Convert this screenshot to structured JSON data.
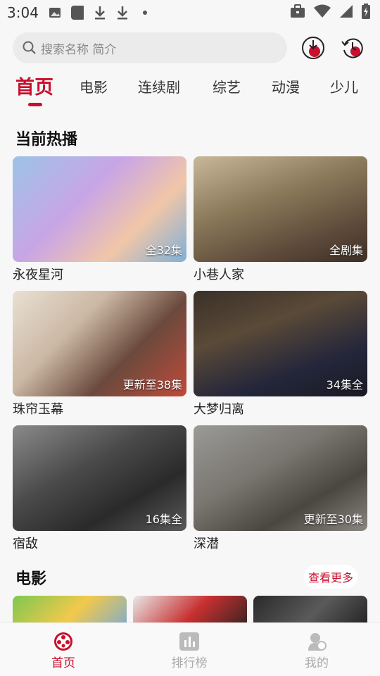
{
  "status_bar": {
    "time": "3:04"
  },
  "search": {
    "placeholder": "搜索名称 简介"
  },
  "tabs": [
    {
      "label": "首页"
    },
    {
      "label": "电影"
    },
    {
      "label": "连续剧"
    },
    {
      "label": "综艺"
    },
    {
      "label": "动漫"
    },
    {
      "label": "少儿"
    }
  ],
  "hot": {
    "title": "当前热播",
    "items": [
      {
        "title": "永夜星河",
        "badge": "全32集"
      },
      {
        "title": "小巷人家",
        "badge": "全剧集"
      },
      {
        "title": "珠帘玉幕",
        "badge": "更新至38集"
      },
      {
        "title": "大梦归离",
        "badge": "34集全"
      },
      {
        "title": "宿敌",
        "badge": "16集全"
      },
      {
        "title": "深潜",
        "badge": "更新至30集"
      }
    ]
  },
  "movies": {
    "title": "电影",
    "more_label": "查看更多"
  },
  "bottom_nav": [
    {
      "label": "首页"
    },
    {
      "label": "排行榜"
    },
    {
      "label": "我的"
    }
  ],
  "colors": {
    "accent": "#c8102e",
    "inactive": "#aaaaaa"
  }
}
